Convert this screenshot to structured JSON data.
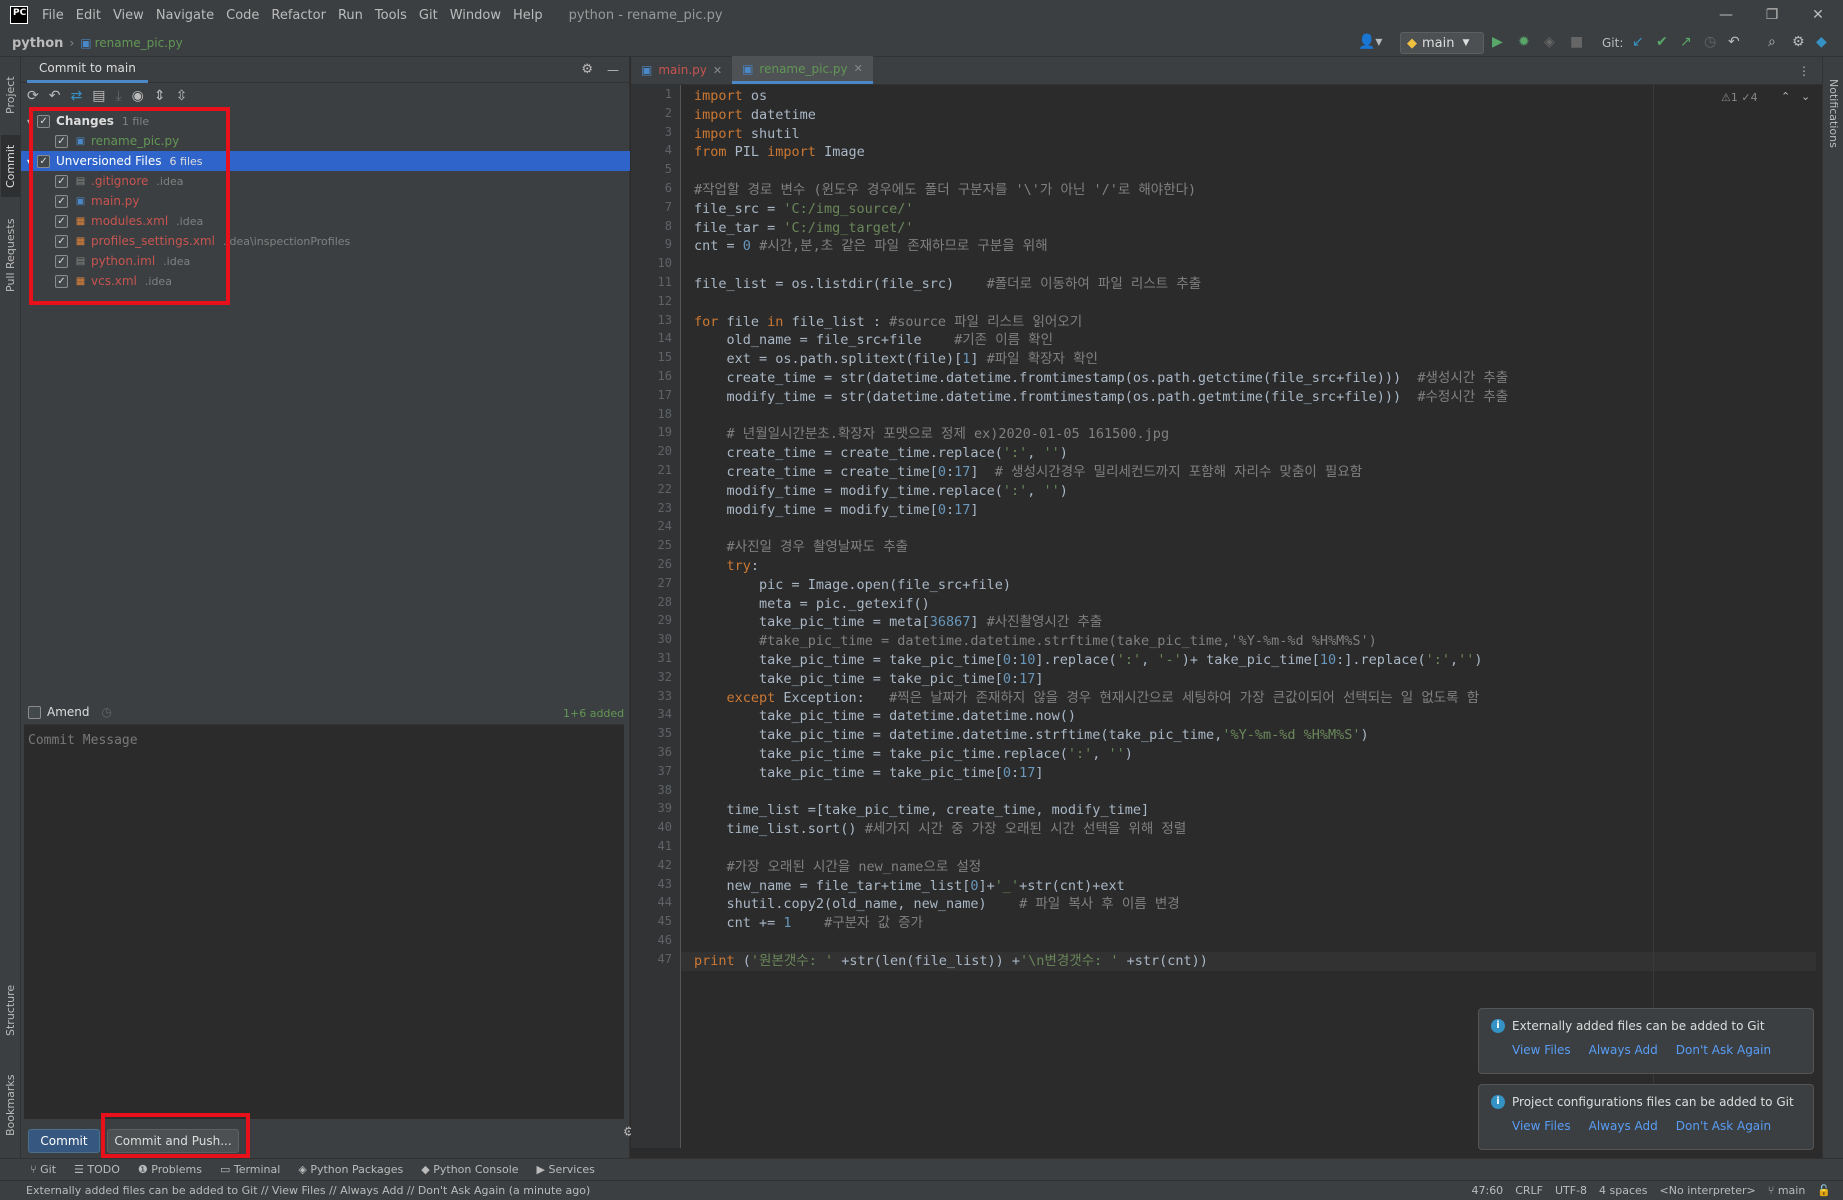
{
  "app": {
    "logo": "PC",
    "title": "python - rename_pic.py"
  },
  "menu": [
    "File",
    "Edit",
    "View",
    "Navigate",
    "Code",
    "Refactor",
    "Run",
    "Tools",
    "Git",
    "Window",
    "Help"
  ],
  "breadcrumb": {
    "project": "python",
    "file": "rename_pic.py"
  },
  "toolbar": {
    "branch": "main",
    "git_label": "Git:"
  },
  "left_tabs": [
    "Project",
    "Commit",
    "Pull Requests",
    "Structure",
    "Bookmarks"
  ],
  "right_tabs": [
    "Notifications"
  ],
  "commit_panel": {
    "tab": "Commit to main",
    "groups": [
      {
        "label": "Changes",
        "count": "1 file",
        "files": [
          {
            "name": "rename_pic.py",
            "path": ""
          }
        ]
      },
      {
        "label": "Unversioned Files",
        "count": "6 files",
        "files": [
          {
            "name": ".gitignore",
            "path": ".idea"
          },
          {
            "name": "main.py",
            "path": ""
          },
          {
            "name": "modules.xml",
            "path": ".idea"
          },
          {
            "name": "profiles_settings.xml",
            "path": ".idea\\inspectionProfiles"
          },
          {
            "name": "python.iml",
            "path": ".idea"
          },
          {
            "name": "vcs.xml",
            "path": ".idea"
          }
        ]
      }
    ],
    "amend": "Amend",
    "added": "1+6 added",
    "message_placeholder": "Commit Message",
    "commit_button": "Commit",
    "commit_push_button": "Commit and Push..."
  },
  "editor": {
    "tabs": [
      {
        "label": "main.py",
        "active": false
      },
      {
        "label": "rename_pic.py",
        "active": true
      }
    ],
    "inspections": "⚠1 ✓4",
    "lines": [
      "import os",
      "import datetime",
      "import shutil",
      "from PIL import Image",
      "",
      "#작업할 경로 변수 (윈도우 경우에도 폴더 구분자를 '\\'가 아닌 '/'로 해야한다)",
      "file_src = 'C:/img_source/'",
      "file_tar = 'C:/img_target/'",
      "cnt = 0 #시간,분,초 같은 파일 존재하므로 구분을 위해",
      "",
      "file_list = os.listdir(file_src)    #폴더로 이동하여 파일 리스트 추출",
      "",
      "for file in file_list : #source 파일 리스트 읽어오기",
      "    old_name = file_src+file    #기존 이름 확인",
      "    ext = os.path.splitext(file)[1] #파일 확장자 확인",
      "    create_time = str(datetime.datetime.fromtimestamp(os.path.getctime(file_src+file)))  #생성시간 추출",
      "    modify_time = str(datetime.datetime.fromtimestamp(os.path.getmtime(file_src+file)))  #수정시간 추출",
      "",
      "    # 년월일시간분초.확장자 포맷으로 정제 ex)2020-01-05 161500.jpg",
      "    create_time = create_time.replace(':', '')",
      "    create_time = create_time[0:17]  # 생성시간경우 밀리세컨드까지 포함해 자리수 맞춤이 필요함",
      "    modify_time = modify_time.replace(':', '')",
      "    modify_time = modify_time[0:17]",
      "",
      "    #사진일 경우 촬영날짜도 추출",
      "    try:",
      "        pic = Image.open(file_src+file)",
      "        meta = pic._getexif()",
      "        take_pic_time = meta[36867] #사진촬영시간 추출",
      "        #take_pic_time = datetime.datetime.strftime(take_pic_time,'%Y-%m-%d %H%M%S')",
      "        take_pic_time = take_pic_time[0:10].replace(':', '-')+ take_pic_time[10:].replace(':','')",
      "        take_pic_time = take_pic_time[0:17]",
      "    except Exception:   #찍은 날짜가 존재하지 않을 경우 현재시간으로 세팅하여 가장 큰값이되어 선택되는 일 없도록 함",
      "        take_pic_time = datetime.datetime.now()",
      "        take_pic_time = datetime.datetime.strftime(take_pic_time,'%Y-%m-%d %H%M%S')",
      "        take_pic_time = take_pic_time.replace(':', '')",
      "        take_pic_time = take_pic_time[0:17]",
      "",
      "    time_list =[take_pic_time, create_time, modify_time]",
      "    time_list.sort() #세가지 시간 중 가장 오래된 시간 선택을 위해 정렬",
      "",
      "    #가장 오래된 시간을 new_name으로 설정",
      "    new_name = file_tar+time_list[0]+'_'+str(cnt)+ext",
      "    shutil.copy2(old_name, new_name)    # 파일 복사 후 이름 변경",
      "    cnt += 1    #구분자 값 증가",
      "",
      "print ('원본갯수: ' +str(len(file_list)) +'\\n변경갯수: ' +str(cnt))"
    ]
  },
  "notifications": [
    {
      "text": "Externally added files can be added to Git",
      "links": [
        "View Files",
        "Always Add",
        "Don't Ask Again"
      ]
    },
    {
      "text": "Project configurations files can be added to Git",
      "links": [
        "View Files",
        "Always Add",
        "Don't Ask Again"
      ]
    }
  ],
  "bottom_tools": [
    "Git",
    "TODO",
    "Problems",
    "Terminal",
    "Python Packages",
    "Python Console",
    "Services"
  ],
  "status": {
    "message": "Externally added files can be added to Git // View Files // Always Add // Don't Ask Again (a minute ago)",
    "position": "47:60",
    "line_sep": "CRLF",
    "encoding": "UTF-8",
    "indent": "4 spaces",
    "interpreter": "<No interpreter>",
    "branch": "main"
  },
  "colors": {
    "accent": "#4a88c7",
    "selection": "#2f65ca",
    "annotation": "#e8101a",
    "unversioned": "#c75450",
    "modified": "#629755"
  }
}
